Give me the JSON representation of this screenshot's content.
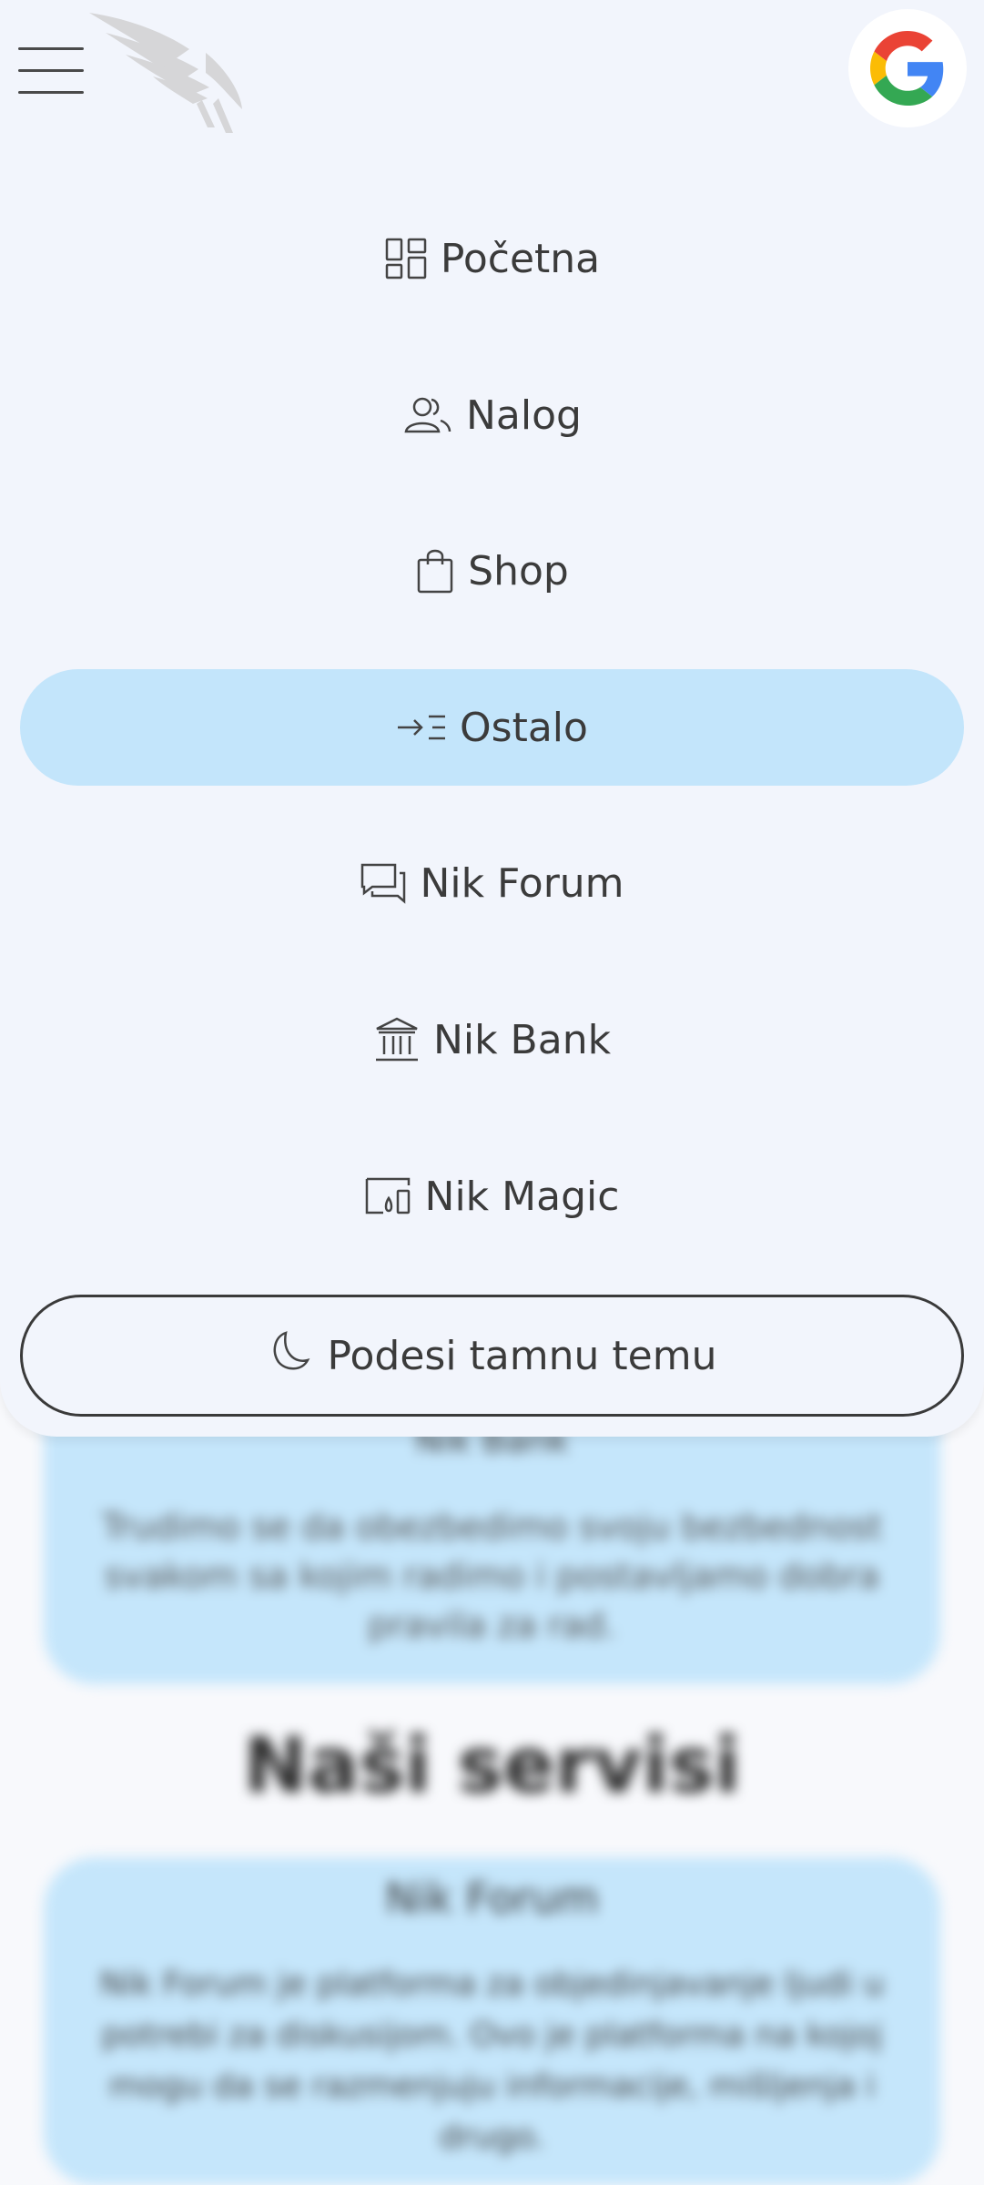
{
  "background": {
    "card1": {
      "title": "Nik Bank",
      "text": "Trudimo se da obezbedimo svoju bezbednost svakom sa kojim radimo i postavljamo dobra pravila za rad."
    },
    "section_title": "Naši servisi",
    "card2": {
      "title": "Nik Forum",
      "text": "Nik Forum je platforma za objedinjavanje ljudi u potrebi za diskusijom. Ovo je platforma na kojoj mogu da se razmenjuju informacije, mišljenja i drugo."
    }
  },
  "nav": {
    "items": [
      {
        "label": "Početna",
        "icon": "dashboard-icon"
      },
      {
        "label": "Nalog",
        "icon": "users-icon"
      },
      {
        "label": "Shop",
        "icon": "shopping-bag-icon"
      },
      {
        "label": "Ostalo",
        "icon": "arrow-list-icon",
        "active": true
      },
      {
        "label": "Nik Forum",
        "icon": "chat-icon"
      },
      {
        "label": "Nik Bank",
        "icon": "bank-icon"
      },
      {
        "label": "Nik Magic",
        "icon": "devices-icon"
      }
    ],
    "theme_button": {
      "label": "Podesi tamnu temu",
      "icon": "moon-icon"
    }
  },
  "colors": {
    "active_item": "#c3e5fb",
    "drawer_bg": "#f2f5fc",
    "card_bg": "#c5e6fb"
  }
}
